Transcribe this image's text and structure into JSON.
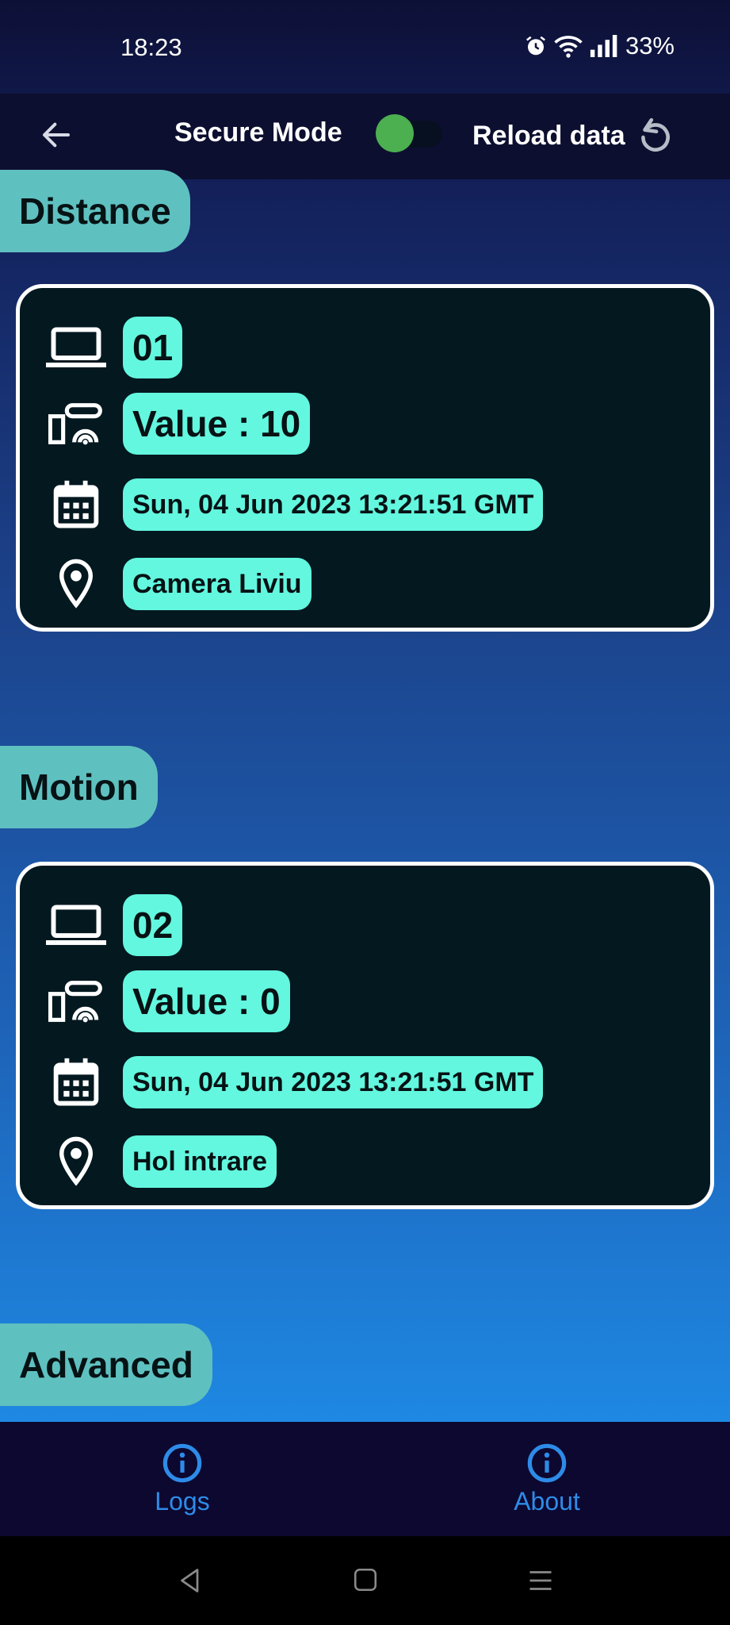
{
  "status_bar": {
    "time": "18:23",
    "battery": "33%"
  },
  "app_bar": {
    "secure_mode_label": "Secure Mode",
    "secure_mode_on": true,
    "reload_label": "Reload data"
  },
  "sections": [
    {
      "title": "Distance",
      "card": {
        "id": "01",
        "value": "Value : 10",
        "timestamp": "Sun, 04 Jun 2023 13:21:51 GMT",
        "location": "Camera Liviu"
      }
    },
    {
      "title": "Motion",
      "card": {
        "id": "02",
        "value": "Value : 0",
        "timestamp": "Sun, 04 Jun 2023 13:21:51 GMT",
        "location": "Hol intrare"
      }
    },
    {
      "title": "Advanced"
    }
  ],
  "bottom_nav": {
    "items": [
      {
        "label": "Logs",
        "icon": "info-icon"
      },
      {
        "label": "About",
        "icon": "info-icon"
      }
    ]
  },
  "colors": {
    "accent_chip": "#63f7df",
    "section_pill": "#5fc0c0",
    "card_bg": "#041820",
    "toggle_on": "#4caf50",
    "nav_accent": "#2e8be8"
  }
}
